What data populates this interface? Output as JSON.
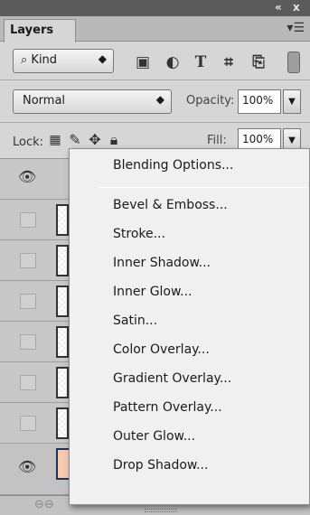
{
  "panel": {
    "tab_label": "Layers",
    "window_controls": {
      "collapse": "«",
      "close": "x"
    },
    "menu_icon": "panel-menu-icon"
  },
  "filter": {
    "kind_label": "Kind",
    "kind_arrows": "⬍",
    "icons": [
      "image-filter-icon",
      "adjustment-filter-icon",
      "type-filter-icon",
      "shape-filter-icon",
      "smart-object-filter-icon"
    ]
  },
  "blend": {
    "mode": "Normal",
    "opacity_label": "Opacity:",
    "opacity_value": "100%"
  },
  "lock": {
    "label": "Lock:",
    "icons": [
      "lock-transparent-icon",
      "lock-image-icon",
      "lock-position-icon",
      "lock-all-icon"
    ],
    "fill_label": "Fill:",
    "fill_value": "100%"
  },
  "context_menu": {
    "items": [
      "Blending Options...",
      "Bevel & Emboss...",
      "Stroke...",
      "Inner Shadow...",
      "Inner Glow...",
      "Satin...",
      "Color Overlay...",
      "Gradient Overlay...",
      "Pattern Overlay...",
      "Outer Glow...",
      "Drop Shadow..."
    ]
  },
  "footer": {
    "link_icon": "link-layers-icon"
  },
  "colors": {
    "panel_bg": "#d6d6d6",
    "titlebar": "#5b5b5b",
    "menu_bg": "#f0f0f0",
    "selected_thumb": "#f6cbb0"
  }
}
